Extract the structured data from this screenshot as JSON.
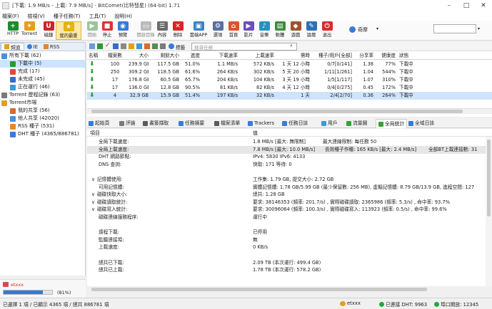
{
  "window": {
    "title": "[下載: 1.9 MB/s - 上載: 7.9 MB/s] - BitComet(比特彗星) (64-bit) 1.71"
  },
  "menu": [
    "檔案(F)",
    "檢視(V)",
    "種子任務(T)",
    "工具(T)",
    "說明(H)"
  ],
  "toolbar": [
    {
      "label": "HTTP",
      "icon": "add-http-icon",
      "color": "#1e8a2b",
      "glyph": "+",
      "disabled": false
    },
    {
      "label": "Torrent",
      "icon": "torrent-icon",
      "color": "#e3a01a",
      "glyph": "✦",
      "disabled": false
    },
    {
      "label": "磁鏈",
      "icon": "magnet-icon",
      "color": "#c8262b",
      "glyph": "U",
      "disabled": false
    },
    {
      "label": "我的最愛",
      "icon": "star-icon",
      "color": "#e7b20b",
      "glyph": "★",
      "disabled": false,
      "selected": true
    },
    {
      "label": "開始",
      "icon": "play-icon",
      "color": "#9cc49c",
      "glyph": "▶",
      "disabled": true
    },
    {
      "label": "停止",
      "icon": "stop-icon",
      "color": "#d33",
      "glyph": "■",
      "disabled": false
    },
    {
      "label": "預覽",
      "icon": "preview-icon",
      "color": "#3a7bd5",
      "glyph": "◉",
      "disabled": false
    },
    {
      "label": "開啟目錄",
      "icon": "folder-icon",
      "color": "#bbb",
      "glyph": "▭",
      "disabled": true
    },
    {
      "label": "內容",
      "icon": "properties-icon",
      "color": "#6a6a6a",
      "glyph": "☰",
      "disabled": false
    },
    {
      "label": "刪除",
      "icon": "delete-icon",
      "color": "#d22",
      "glyph": "✕",
      "disabled": false
    },
    {
      "label": "雲端APP",
      "icon": "cloud-app-icon",
      "color": "#3b82c4",
      "glyph": "▣",
      "disabled": false
    },
    {
      "label": "選項",
      "icon": "options-icon",
      "color": "#5a6fa0",
      "glyph": "⚙",
      "disabled": false
    },
    {
      "label": "首頁",
      "icon": "home-icon",
      "color": "#d8552b",
      "glyph": "⌂",
      "disabled": false
    },
    {
      "label": "影片",
      "icon": "video-icon",
      "color": "#6b4fb5",
      "glyph": "▶",
      "disabled": false
    },
    {
      "label": "音樂",
      "icon": "music-icon",
      "color": "#2a8fbf",
      "glyph": "♪",
      "disabled": false
    },
    {
      "label": "軟體",
      "icon": "software-icon",
      "color": "#3c8c3c",
      "glyph": "▤",
      "disabled": false
    },
    {
      "label": "遊戲",
      "icon": "game-icon",
      "color": "#a0522d",
      "glyph": "◆",
      "disabled": false
    },
    {
      "label": "論壇",
      "icon": "forum-icon",
      "color": "#2d6fb5",
      "glyph": "✎",
      "disabled": false
    },
    {
      "label": "退出",
      "icon": "exit-icon",
      "color": "#d82b2b",
      "glyph": "⏻",
      "disabled": false
    }
  ],
  "favorites": {
    "label": "奇摩",
    "search_placeholder": ""
  },
  "sidebar": {
    "tabs": [
      "頻道",
      "IE",
      "RSS"
    ],
    "items": [
      {
        "label": "所有下載 (62)",
        "indent": 0,
        "icon": "all-downloads-icon",
        "color": "#4a90d9"
      },
      {
        "label": "下載中 (5)",
        "indent": 1,
        "icon": "downloading-icon",
        "color": "#2a9b2a",
        "selected": true
      },
      {
        "label": "完成 (17)",
        "indent": 1,
        "icon": "completed-icon",
        "color": "#d84a4a"
      },
      {
        "label": "未完成 (45)",
        "indent": 1,
        "icon": "incomplete-icon",
        "color": "#3a6ac9"
      },
      {
        "label": "正在運行 (46)",
        "indent": 1,
        "icon": "running-icon",
        "color": "#3a9bd5"
      },
      {
        "label": "Torrent 歷程記錄 (63)",
        "indent": 0,
        "icon": "history-icon",
        "color": "#7a7a7a"
      },
      {
        "label": "Torrent市場",
        "indent": 0,
        "icon": "market-icon",
        "color": "#e3a01a"
      },
      {
        "label": "我的共享 (56)",
        "indent": 1,
        "icon": "my-share-icon",
        "color": "#d86a2b"
      },
      {
        "label": "他人共享 (42020)",
        "indent": 1,
        "icon": "others-share-icon",
        "color": "#4a90d9"
      },
      {
        "label": "RSS 種子 (531)",
        "indent": 1,
        "icon": "rss-icon",
        "color": "#e8842a"
      },
      {
        "label": "DHT 種子 (4365/886781)",
        "indent": 1,
        "icon": "dht-icon",
        "color": "#3a7bd5"
      }
    ],
    "footer": {
      "user": "etxxx",
      "progress_label": "(81%)",
      "progress": 0.81
    }
  },
  "list": {
    "search_placeholder": "搜尋任務",
    "tag_label": "標籤",
    "columns": [
      "名稱",
      "檔案數",
      "大小",
      "剩餘大小",
      "進度",
      "下載速率",
      "上載速率",
      "需時",
      "種子/用戶[全部]",
      "分享率",
      "健康度",
      "狀態"
    ],
    "rows": [
      {
        "files": "100",
        "size": "239.9 GB",
        "left": "117.5 GB",
        "progress": "51.0%",
        "down": "1.1 MB/s",
        "up": "572 KB/s",
        "eta": "1 天 12 小時",
        "seeds": "0/7[0/141]",
        "ratio": "1.38",
        "health": "77%",
        "status": "下載中",
        "selected": false
      },
      {
        "files": "250",
        "size": "309.2 GB",
        "left": "118.5 GB",
        "progress": "61.6%",
        "down": "264 KB/s",
        "up": "302 KB/s",
        "eta": "5 天 20 小時",
        "seeds": "1/11[1/261]",
        "ratio": "1.04",
        "health": "544%",
        "status": "下載中",
        "selected": false
      },
      {
        "files": "17",
        "size": "176.8 GB",
        "left": "60.5 GB",
        "progress": "65.7%",
        "down": "204 KB/s",
        "up": "104 KB/s",
        "eta": "3 天 19 小時",
        "seeds": "1/5[1/117]",
        "ratio": "1.07",
        "health": "310%",
        "status": "下載中",
        "selected": false
      },
      {
        "files": "17",
        "size": "136.0 GB",
        "left": "12.8 GB",
        "progress": "90.5%",
        "down": "81 KB/s",
        "up": "82 KB/s",
        "eta": "4 天 12 小時",
        "seeds": "0/4[0/275]",
        "ratio": "0.45",
        "health": "172%",
        "status": "下載中",
        "selected": false
      },
      {
        "files": "4",
        "size": "32.9 GB",
        "left": "15.9 GB",
        "progress": "51.4%",
        "down": "197 KB/s",
        "up": "32 KB/s",
        "eta": "1 天",
        "seeds": "2/4[2/70]",
        "ratio": "0.36",
        "health": "264%",
        "status": "下載中",
        "selected": true
      }
    ]
  },
  "bottom_tabs": [
    {
      "label": "起始頁",
      "color": "#3a7bd5"
    },
    {
      "label": "評論",
      "color": "#7a7a7a"
    },
    {
      "label": "書簽擷取",
      "color": "#5a5a5a"
    },
    {
      "label": "任務摘要",
      "color": "#3a7bd5"
    },
    {
      "label": "檔案清單",
      "color": "#5a5a5a"
    },
    {
      "label": "Trackers",
      "color": "#3a7bd5"
    },
    {
      "label": "任務日誌",
      "color": "#3a7bd5"
    },
    {
      "label": "用戶",
      "color": "#3a9bd5"
    },
    {
      "label": "流量圖",
      "color": "#3aa03a"
    },
    {
      "label": "全局統計",
      "color": "#3aa03a",
      "active": true
    },
    {
      "label": "全域日誌",
      "color": "#3a7bd5"
    }
  ],
  "stats": {
    "header_key": "項目",
    "header_value": "值",
    "rows": [
      {
        "key": "全局下載速度:",
        "value": "1.8 MB/s [最大: 無限制]",
        "extra": "最大連線限制: 每任務 50",
        "indent": 1
      },
      {
        "key": "全局上載速度:",
        "value": "7.8 MB/s [最大: 10.0 MB/s]",
        "extra": "長效種子作種: 165 KB/s [最大: 2.4 MB/s]",
        "extra2": "全部BT上載連接數: 31",
        "indent": 1,
        "highlight": true
      },
      {
        "key": "DHT 網路節點:",
        "value": "IPv4: 5830  IPv6: 4133",
        "indent": 1
      },
      {
        "key": "DNS 查詢:",
        "value": "快取: 171   等待: 0",
        "indent": 1
      },
      {
        "key": "",
        "value": "",
        "indent": 1
      },
      {
        "key": "記憶體使用:",
        "value": "工作集: 1.79 GB, 提交大小: 2.72 GB",
        "indent": 0,
        "expand": true
      },
      {
        "key": "可用記憶體:",
        "value": "實體記憶體: 1.78 GB/5.99 GB (最少保留數: 256 MB), 虛擬記憶體: 8.79 GB/13.9 GB, 進程空間: 127",
        "indent": 1
      },
      {
        "key": "磁碟快取大小:",
        "value": "總共: 1.28 GB",
        "indent": 0,
        "expand": true
      },
      {
        "key": "磁碟讀取統計:",
        "value": "要求: 38146353 (頻率: 201.7/s) , 實際磁碟讀取: 2365986 (頻率: 5.3/s) , 命中率: 93.7%",
        "indent": 0,
        "expand": true
      },
      {
        "key": "磁碟寫入統計:",
        "value": "要求: 30096064 (頻率: 100.3/s) , 實際磁碟寫入: 113923 (頻率: 0.5/s) , 命中率: 99.6%",
        "indent": 0,
        "expand": true
      },
      {
        "key": "磁碟連線服務程序:",
        "value": "運行中",
        "indent": 1
      },
      {
        "key": "",
        "value": "",
        "indent": 1
      },
      {
        "key": "遠程下載:",
        "value": "已停用",
        "indent": 1
      },
      {
        "key": "監聽連接埠:",
        "value": "無",
        "indent": 1
      },
      {
        "key": "上載速度:",
        "value": "0 KB/s",
        "indent": 1
      },
      {
        "key": "",
        "value": "",
        "indent": 1
      },
      {
        "key": "總共已下載:",
        "value": "2.09 TB (本次運行: 499.4 GB)",
        "indent": 1
      },
      {
        "key": "總共已上載:",
        "value": "1.78 TB (本次運行: 578.2 GB)",
        "indent": 1
      }
    ]
  },
  "statusbar": {
    "selection": "已選擇 1 項 / 已顯示 4365 項 / 總共 886781 項",
    "user": "etxxx",
    "dht": "已連接 DHT: 9963",
    "port": "埠口開放: 12345"
  }
}
